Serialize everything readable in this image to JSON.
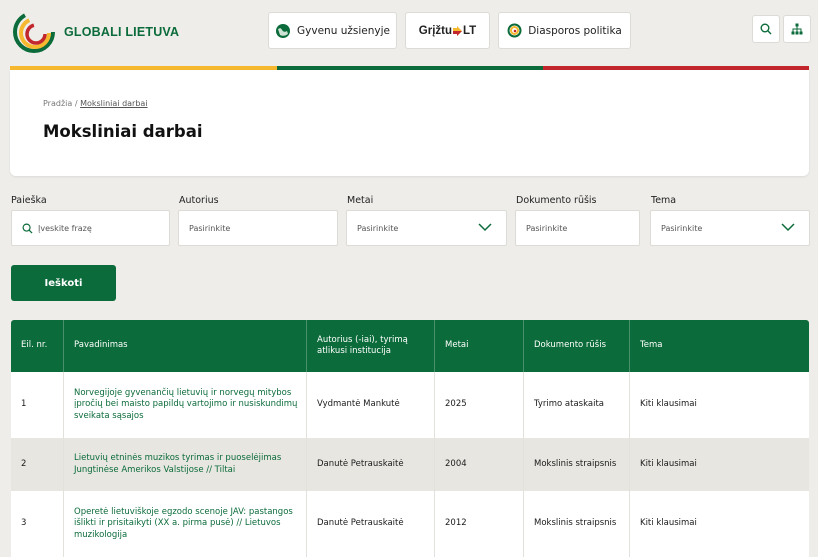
{
  "header": {
    "logo_text": "GLOBALI LIETUVA",
    "sites": [
      {
        "label": "Gyvenu užsienyje",
        "icon": "globe-icon"
      },
      {
        "label": "Grįžtu",
        "suffix": "LT",
        "icon": "arrow-icon"
      },
      {
        "label": "Diasporos politika",
        "icon": "ring-icon"
      }
    ],
    "search_icon": "search-icon",
    "sitemap_icon": "sitemap-icon"
  },
  "colors": {
    "green": "#0b6b3a",
    "yellow": "#f5b82e",
    "red": "#c1272d"
  },
  "breadcrumb": {
    "home": "Pradžia",
    "separator": " / ",
    "current": "Moksliniai darbai"
  },
  "page_title": "Moksliniai darbai",
  "filters": {
    "search": {
      "label": "Paieška",
      "placeholder": "Įveskite frazę"
    },
    "author": {
      "label": "Autorius",
      "placeholder": "Pasirinkite"
    },
    "year": {
      "label": "Metai",
      "placeholder": "Pasirinkite"
    },
    "doc_type": {
      "label": "Dokumento rūšis",
      "placeholder": "Pasirinkite"
    },
    "topic": {
      "label": "Tema",
      "placeholder": "Pasirinkite"
    },
    "submit": "Ieškoti"
  },
  "table": {
    "headers": [
      "Eil. nr.",
      "Pavadinimas",
      "Autorius (-iai), tyrimą atlikusi institucija",
      "Metai",
      "Dokumento rūšis",
      "Tema"
    ],
    "rows": [
      {
        "nr": "1",
        "title": "Norvegijoje gyvenančių lietuvių ir norvegų mitybos įpročių bei maisto papildų vartojimo ir nusiskundimų sveikata sąsajos",
        "author": "Vydmantė Mankutė",
        "year": "2025",
        "type": "Tyrimo ataskaita",
        "topic": "Kiti klausimai"
      },
      {
        "nr": "2",
        "title": "Lietuvių etninės muzikos tyrimas ir puoselėjimas Jungtinėse Amerikos Valstijose // Tiltai",
        "author": "Danutė Petrauskaitė",
        "year": "2004",
        "type": "Mokslinis straipsnis",
        "topic": "Kiti klausimai"
      },
      {
        "nr": "3",
        "title": "Operetė lietuviškoje egzodo scenoje JAV: pastangos išlikti ir prisitaikyti (XX a. pirma pusė) // Lietuvos muzikologija",
        "author": "Danutė Petrauskaitė",
        "year": "2012",
        "type": "Mokslinis straipsnis",
        "topic": "Kiti klausimai"
      }
    ]
  }
}
